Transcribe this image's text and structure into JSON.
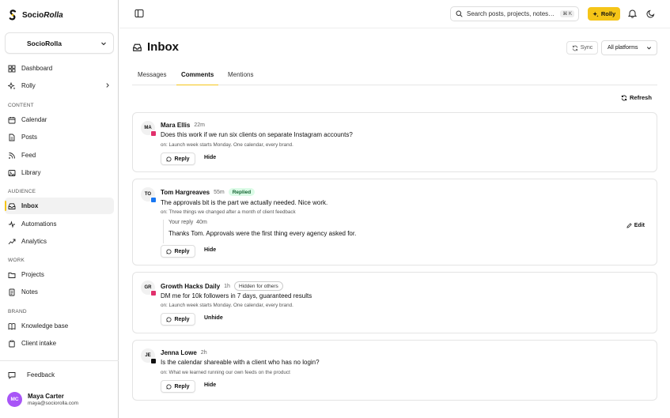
{
  "brand": {
    "name_a": "Socio",
    "name_b": "Rolla"
  },
  "workspace": {
    "name": "SocioRolla"
  },
  "nav": {
    "dashboard": "Dashboard",
    "rolly": "Rolly",
    "section_content": "CONTENT",
    "calendar": "Calendar",
    "posts": "Posts",
    "feed": "Feed",
    "library": "Library",
    "section_audience": "AUDIENCE",
    "inbox": "Inbox",
    "automations": "Automations",
    "analytics": "Analytics",
    "section_work": "WORK",
    "projects": "Projects",
    "notes": "Notes",
    "section_brand": "BRAND",
    "knowledge_base": "Knowledge base",
    "client_intake": "Client intake",
    "feedback": "Feedback"
  },
  "user": {
    "initials": "MC",
    "name": "Maya Carter",
    "email": "maya@sociorolla.com"
  },
  "topbar": {
    "search_placeholder": "Search posts, projects, notes…",
    "shortcut": "⌘ K",
    "rolly_label": "Rolly"
  },
  "page": {
    "title": "Inbox",
    "sync_label": "Sync",
    "platform_filter": "All platforms",
    "refresh_label": "Refresh"
  },
  "tabs": [
    "Messages",
    "Comments",
    "Mentions"
  ],
  "active_tab": "Comments",
  "colors": {
    "accent": "#f5c518",
    "instagram": "#e1306c",
    "facebook": "#1877f2",
    "threads": "#111111"
  },
  "comments": [
    {
      "initials": "MA",
      "name": "Mara Ellis",
      "time": "22m",
      "platform": "instagram",
      "text": "Does this work if we run six clients on separate Instagram accounts?",
      "on": "on: Launch week starts Monday. One calendar, every brand.",
      "reply_label": "Reply",
      "action_label": "Hide"
    },
    {
      "initials": "TO",
      "name": "Tom Hargreaves",
      "time": "55m",
      "platform": "facebook",
      "status": "Replied",
      "text": "The approvals bit is the part we actually needed. Nice work.",
      "on": "on: Three things we changed after a month of client feedback",
      "your_reply_label": "Your reply",
      "your_reply_time": "40m",
      "your_reply_text": "Thanks Tom. Approvals were the first thing every agency asked for.",
      "edit_label": "Edit",
      "reply_label": "Reply",
      "action_label": "Hide"
    },
    {
      "initials": "GR",
      "name": "Growth Hacks Daily",
      "time": "1h",
      "platform": "instagram",
      "status": "Hidden for others",
      "text": "DM me for 10k followers in 7 days, guaranteed results",
      "on": "on: Launch week starts Monday. One calendar, every brand.",
      "reply_label": "Reply",
      "action_label": "Unhide"
    },
    {
      "initials": "JE",
      "name": "Jenna Lowe",
      "time": "2h",
      "platform": "threads",
      "text": "Is the calendar shareable with a client who has no login?",
      "on": "on: What we learned running our own feeds on the product",
      "reply_label": "Reply",
      "action_label": "Hide"
    }
  ]
}
